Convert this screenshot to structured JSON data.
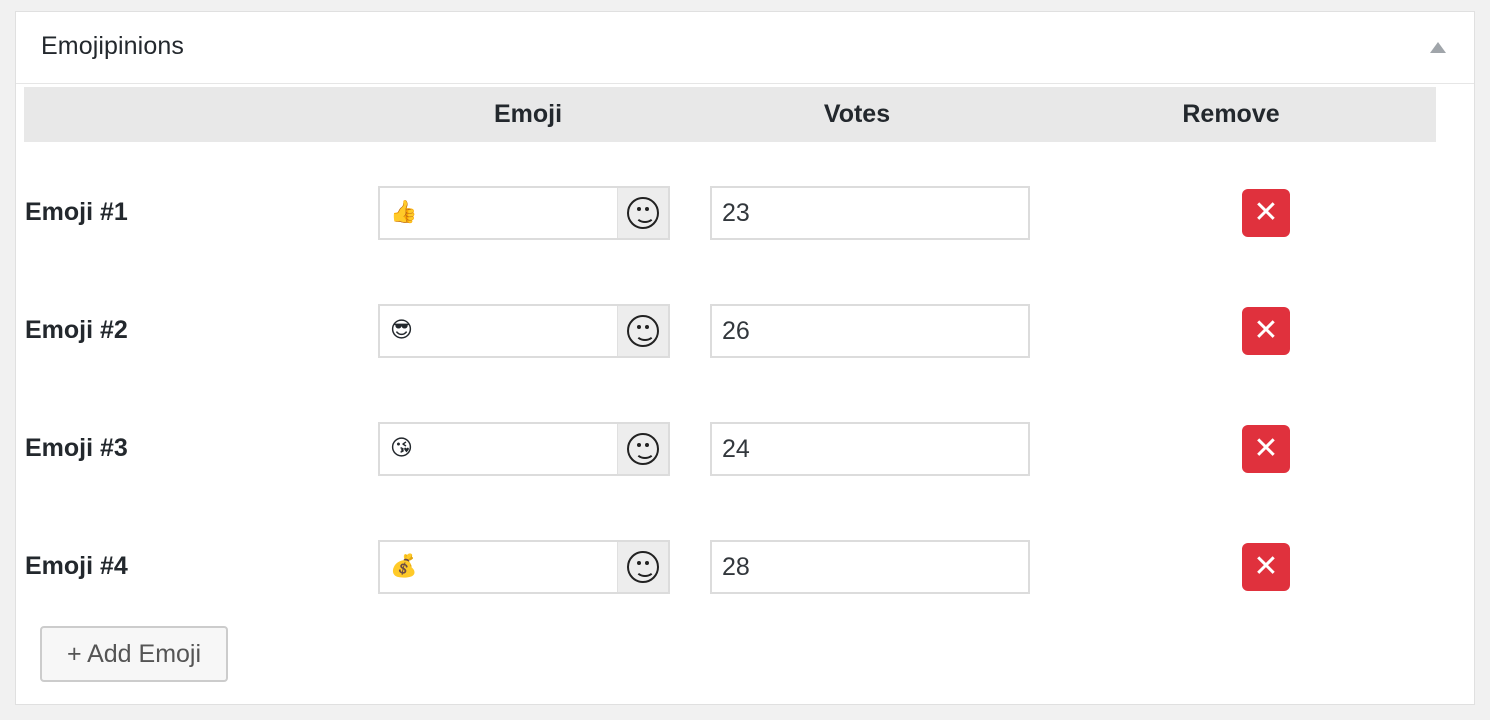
{
  "panel": {
    "title": "Emojipinions"
  },
  "table": {
    "headers": {
      "emoji": "Emoji",
      "votes": "Votes",
      "remove": "Remove"
    },
    "rows": [
      {
        "label": "Emoji #1",
        "emoji": "👍",
        "votes": "23"
      },
      {
        "label": "Emoji #2",
        "emoji": "😎",
        "votes": "26"
      },
      {
        "label": "Emoji #3",
        "emoji": "😘",
        "votes": "24"
      },
      {
        "label": "Emoji #4",
        "emoji": "💰",
        "votes": "28"
      }
    ]
  },
  "actions": {
    "add_label": "+ Add Emoji"
  },
  "colors": {
    "remove": "#e0313d",
    "header_bg": "#e8e8e8"
  },
  "icons": {
    "toggle": "triangle-up-icon",
    "picker": "smiley-face-icon",
    "remove": "close-x-icon"
  }
}
